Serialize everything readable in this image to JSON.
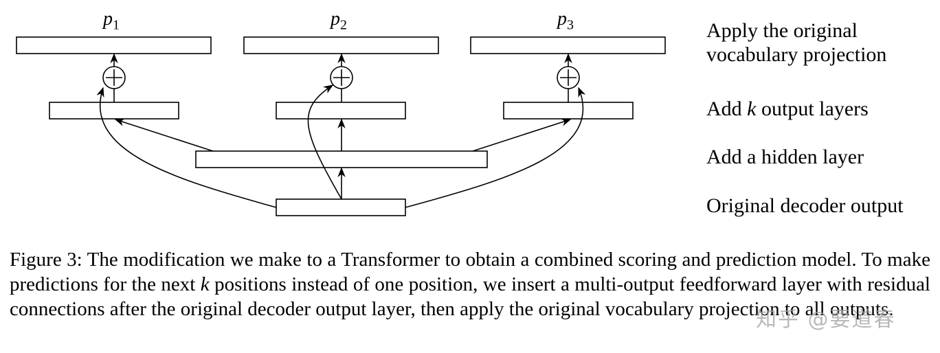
{
  "figure": {
    "outputs": [
      {
        "symbol": "p",
        "subscript": "1"
      },
      {
        "symbol": "p",
        "subscript": "2"
      },
      {
        "symbol": "p",
        "subscript": "3"
      }
    ],
    "layer_labels": {
      "projection_line1": "Apply the original",
      "projection_line2": "vocabulary projection",
      "output_layers_prefix": "Add ",
      "output_layers_var": "k",
      "output_layers_suffix": " output layers",
      "hidden_layer": "Add a hidden layer",
      "decoder_output": "Original decoder output"
    },
    "residual_symbol": "+"
  },
  "caption": {
    "part1": "Figure 3: The modification we make to a Transformer to obtain a combined scoring and prediction model. To make predictions for the next ",
    "var": "k",
    "part2": " positions instead of one position, we insert a multi-output feedforward layer with residual connections after the original decoder output layer, then apply the original vocabulary projection to all outputs."
  },
  "watermark": "知乎 @要道春"
}
